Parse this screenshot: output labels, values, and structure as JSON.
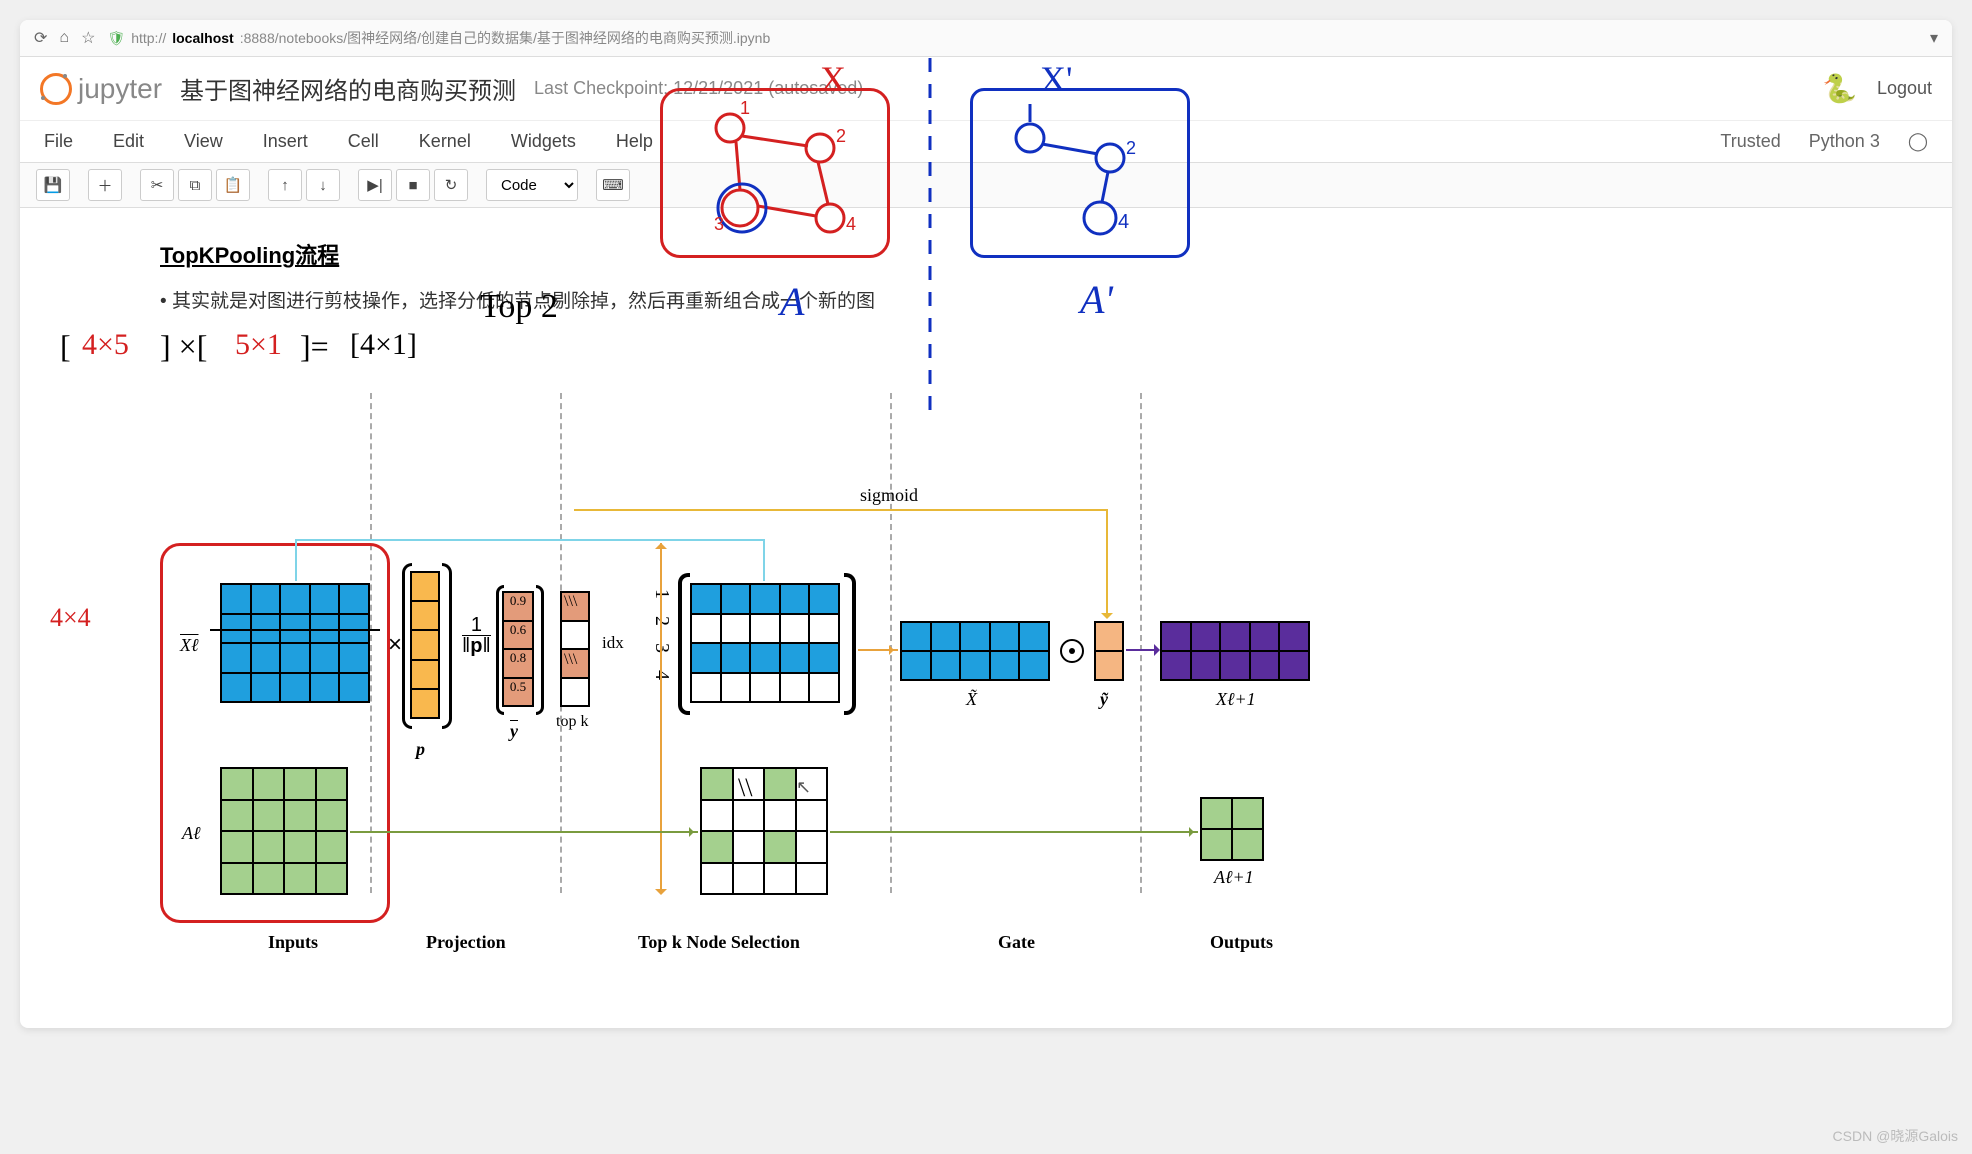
{
  "browser": {
    "url_prefix": "http://",
    "url_host": "localhost",
    "url_port": ":8888/notebooks/图神经网络/创建自己的数据集/基于图神经网络的电商购买预测.ipynb"
  },
  "header": {
    "jupyter": "jupyter",
    "title": "基于图神经网络的电商购买预测",
    "checkpoint": "Last Checkpoint: 12/21/2021 (autosaved)",
    "logout": "Logout"
  },
  "menu": {
    "items": [
      "File",
      "Edit",
      "View",
      "Insert",
      "Cell",
      "Kernel",
      "Widgets",
      "Help"
    ],
    "trusted": "Trusted",
    "kernel": "Python 3"
  },
  "toolbar": {
    "cell_type": "Code"
  },
  "content": {
    "heading": "TopKPooling流程",
    "bullet": "其实就是对图进行剪枝操作，选择分低的节点剔除掉，然后再重新组合成一个新的图"
  },
  "diagram": {
    "sections": [
      "Inputs",
      "Projection",
      "Top k Node Selection",
      "Gate",
      "Outputs"
    ],
    "labels": {
      "Xl": "Xℓ",
      "Al": "Aℓ",
      "p": "p",
      "norm": "1/‖p‖",
      "y": "y",
      "topk": "top k",
      "idx": "idx",
      "sigmoid": "sigmoid",
      "Xtilde": "X̃",
      "ytilde": "ỹ",
      "Xl1": "Xℓ+1",
      "Al1": "Aℓ+1"
    },
    "y_values": [
      "0.9",
      "0.6",
      "0.8",
      "0.5"
    ]
  },
  "annotations": {
    "matmul": "[ 4×5 ] × [ 5×1 ] = [4×1]",
    "top2": "Top 2",
    "fourbyfour": "4×4",
    "X": "X",
    "Xprime": "X'",
    "A": "A",
    "Aprime": "A'",
    "idx_vert": "1 2 3 4"
  },
  "watermark": "CSDN @晓源Galois"
}
